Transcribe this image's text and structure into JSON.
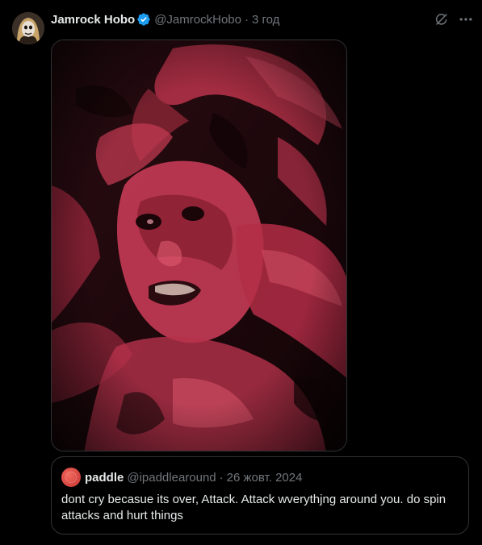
{
  "post": {
    "display_name": "Jamrock Hobo",
    "handle": "@JamrockHobo",
    "separator": "·",
    "time": "3 год",
    "verified_color": "#1d9bf0"
  },
  "icons": {
    "verified": "verified-badge-icon",
    "grok": "grok-icon",
    "more": "more-options-icon"
  },
  "media": {
    "kind": "image",
    "palette": [
      "#0d0507",
      "#c23a52",
      "#e05a6f",
      "#3a0f18"
    ]
  },
  "quote": {
    "display_name": "paddle",
    "handle": "@ipaddlearound",
    "separator": "·",
    "date": "26 жовт. 2024",
    "text": "dont cry becasue its over, Attack. Attack wverythjng around you. do spin attacks and hurt things"
  },
  "colors": {
    "background": "#000000",
    "text_primary": "#e7e9ea",
    "text_secondary": "#71767b",
    "border": "#2f3336",
    "accent": "#1d9bf0"
  }
}
